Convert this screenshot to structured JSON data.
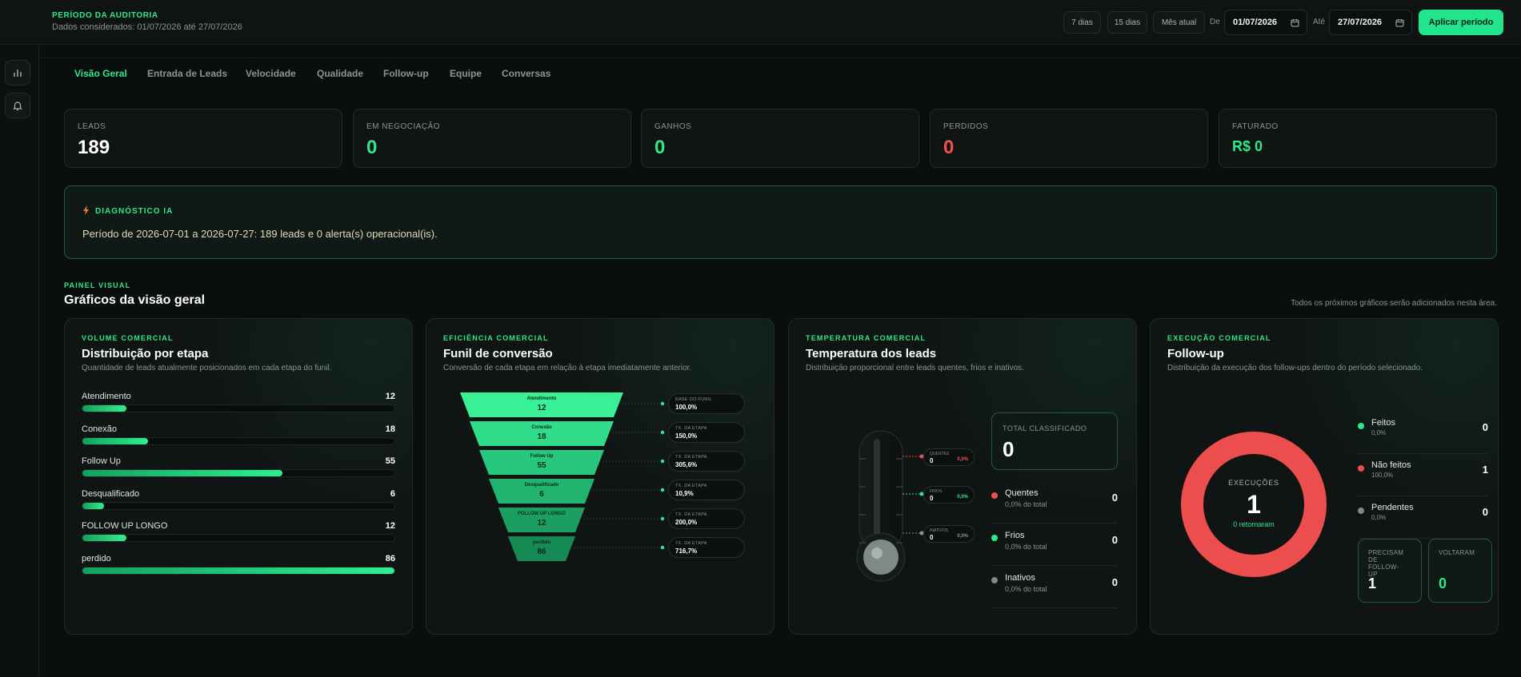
{
  "period": {
    "title": "PERÍODO DA AUDITORIA",
    "subtitle": "Dados considerados: 01/07/2026 até 27/07/2026",
    "quick_ranges": [
      "7 dias",
      "15 dias",
      "Mês atual"
    ],
    "from_label": "De",
    "from_value": "01/07/2026",
    "to_label": "Até",
    "to_value": "27/07/2026",
    "apply_label": "Aplicar período"
  },
  "tabs": [
    "Visão Geral",
    "Entrada de Leads",
    "Velocidade",
    "Qualidade",
    "Follow-up",
    "Equipe",
    "Conversas"
  ],
  "kpis": [
    {
      "label": "LEADS",
      "value": "189",
      "color": "#ffffff"
    },
    {
      "label": "EM NEGOCIAÇÃO",
      "value": "0",
      "color": "#2ee88a"
    },
    {
      "label": "GANHOS",
      "value": "0",
      "color": "#2ee88a"
    },
    {
      "label": "PERDIDOS",
      "value": "0",
      "color": "#f0504f"
    },
    {
      "label": "FATURADO",
      "value": "R$ 0",
      "color": "#2ee88a"
    }
  ],
  "diagnostic": {
    "title": "DIAGNÓSTICO IA",
    "text": "Período de 2026-07-01 a 2026-07-27: 189 leads e 0 alerta(s) operacional(is)."
  },
  "panel": {
    "label": "PAINEL VISUAL",
    "title": "Gráficos da visão geral",
    "note": "Todos os próximos gráficos serão adicionados nesta área."
  },
  "volume": {
    "kicker": "VOLUME COMERCIAL",
    "title": "Distribuição por etapa",
    "subtitle": "Quantidade de leads atualmente posicionados em cada etapa do funil.",
    "rows": [
      {
        "name": "Atendimento",
        "value": "12",
        "fraction": 0.14
      },
      {
        "name": "Conexão",
        "value": "18",
        "fraction": 0.21
      },
      {
        "name": "Follow Up",
        "value": "55",
        "fraction": 0.64
      },
      {
        "name": "Desqualificado",
        "value": "6",
        "fraction": 0.07
      },
      {
        "name": "FOLLOW UP LONGO",
        "value": "12",
        "fraction": 0.14
      },
      {
        "name": "perdido",
        "value": "86",
        "fraction": 1.0
      }
    ]
  },
  "funnel": {
    "kicker": "EFICIÊNCIA COMERCIAL",
    "title": "Funil de conversão",
    "subtitle": "Conversão de cada etapa em relação à etapa imediatamente anterior.",
    "stages": [
      {
        "name": "Atendimento",
        "value": "12",
        "rate_label": "BASE DO FUNIL",
        "rate": "100,0%",
        "color": "#3af096"
      },
      {
        "name": "Conexão",
        "value": "18",
        "rate_label": "TX. DA ETAPA",
        "rate": "150,0%",
        "color": "#30dc8a"
      },
      {
        "name": "Follow Up",
        "value": "55",
        "rate_label": "TX. DA ETAPA",
        "rate": "305,6%",
        "color": "#27c87c"
      },
      {
        "name": "Desqualificado",
        "value": "6",
        "rate_label": "TX. DA ETAPA",
        "rate": "10,9%",
        "color": "#20b46e"
      },
      {
        "name": "FOLLOW UP LONGO",
        "value": "12",
        "rate_label": "TX. DA ETAPA",
        "rate": "200,0%",
        "color": "#1a9f61"
      },
      {
        "name": "perdido",
        "value": "86",
        "rate_label": "TX. DA ETAPA",
        "rate": "716,7%",
        "color": "#168a54"
      }
    ]
  },
  "temperature": {
    "kicker": "TEMPERATURA COMERCIAL",
    "title": "Temperatura dos leads",
    "subtitle": "Distribuição proporcional entre leads quentes, frios e inativos.",
    "total_label": "TOTAL CLASSIFICADO",
    "total_value": "0",
    "gauge": [
      {
        "label": "QUENTES",
        "value": "0",
        "pct": "0,0%",
        "color": "#f0504f"
      },
      {
        "label": "FRIOS",
        "value": "0",
        "pct": "0,0%",
        "color": "#2ee88a"
      },
      {
        "label": "INATIVOS",
        "value": "0",
        "pct": "0,0%",
        "color": "#8a958f"
      }
    ],
    "rows": [
      {
        "name": "Quentes",
        "pct": "0,0% do total",
        "value": "0",
        "color": "#f0504f"
      },
      {
        "name": "Frios",
        "pct": "0,0% do total",
        "value": "0",
        "color": "#2ee88a"
      },
      {
        "name": "Inativos",
        "pct": "0,0% do total",
        "value": "0",
        "color": "#7f8985"
      }
    ]
  },
  "followup": {
    "kicker": "EXECUÇÃO COMERCIAL",
    "title": "Follow-up",
    "subtitle": "Distribuição da execução dos follow-ups dentro do período selecionado.",
    "donut_label": "EXECUÇÕES",
    "donut_value": "1",
    "donut_sub": "0 retornaram",
    "rows": [
      {
        "name": "Feitos",
        "pct": "0,0%",
        "value": "0",
        "color": "#2ee88a"
      },
      {
        "name": "Não feitos",
        "pct": "100,0%",
        "value": "1",
        "color": "#ec4d4d"
      },
      {
        "name": "Pendentes",
        "pct": "0,0%",
        "value": "0",
        "color": "#7f8985"
      }
    ],
    "box1_label": "PRECISAM DE FOLLOW-UP",
    "box1_value": "1",
    "box2_label": "VOLTARAM",
    "box2_value": "0"
  }
}
